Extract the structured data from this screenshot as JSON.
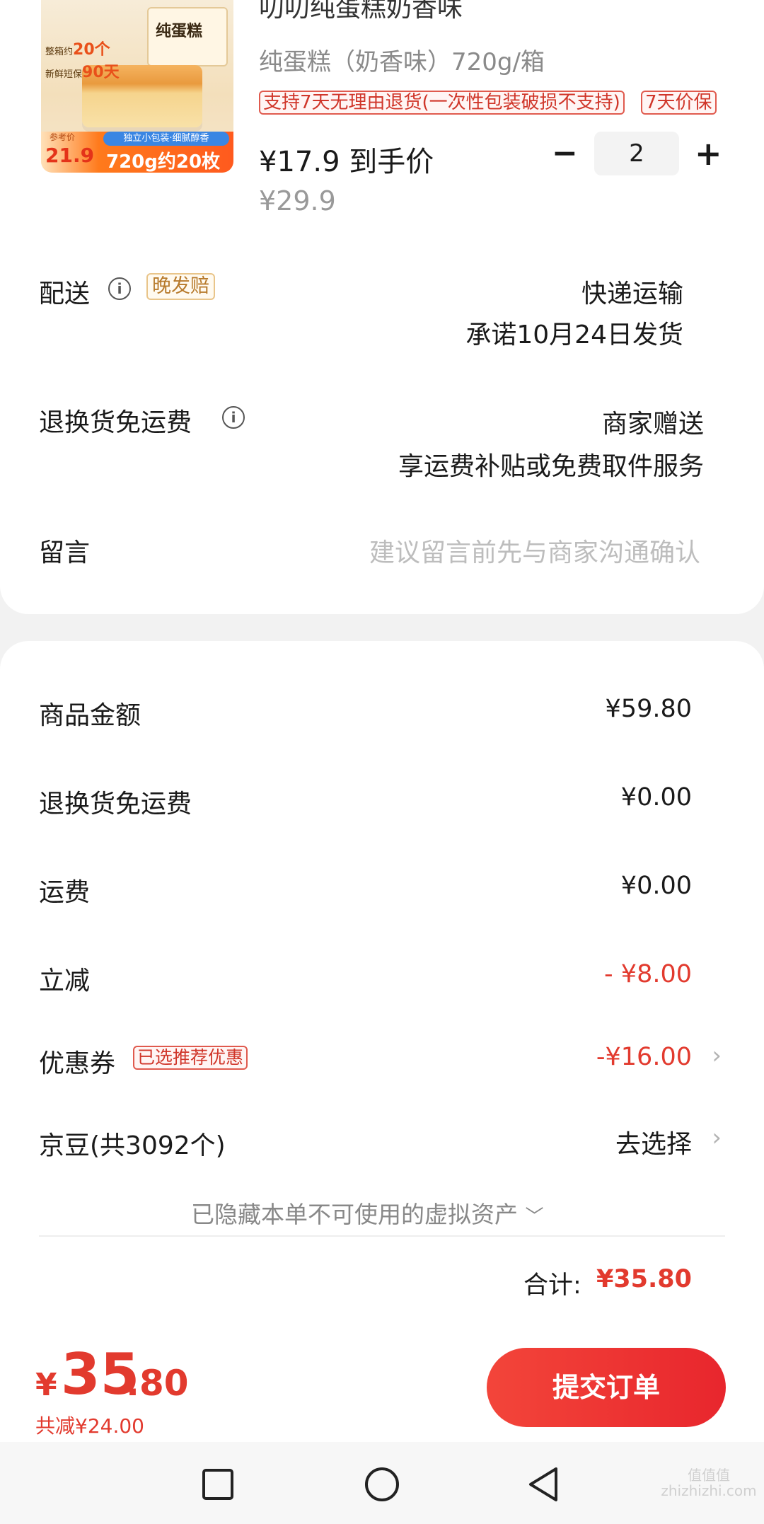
{
  "product": {
    "title_partial": "叨叨纯蛋糕奶香味",
    "spec": "纯蛋糕（奶香味）720g/箱",
    "tag_return": "支持7天无理由退货(一次性包装破损不支持)",
    "tag_price_protect": "7天价保",
    "final_price": "¥17.9 到手价",
    "original_price": "¥29.9",
    "quantity": "2",
    "minus_label": "−",
    "plus_label": "+",
    "image": {
      "box_title": "纯蛋糕",
      "note1_prefix": "整箱约",
      "note1_value": "20个",
      "note2_prefix": "新鲜短保",
      "note2_value": "90天",
      "ref_label": "参考价",
      "ref_price": "21.9",
      "pill": "独立小包装·细腻醇香",
      "spec": "720g约20枚"
    }
  },
  "delivery": {
    "label": "配送",
    "badge": "晚发赔",
    "method": "快递运输",
    "promise": "承诺10月24日发货"
  },
  "return_shipping": {
    "label": "退换货免运费",
    "value1": "商家赠送",
    "value2": "享运费补贴或免费取件服务"
  },
  "message": {
    "label": "留言",
    "placeholder": "建议留言前先与商家沟通确认"
  },
  "summary": {
    "rows": [
      {
        "label": "商品金额",
        "value": "¥59.80"
      },
      {
        "label": "退换货免运费",
        "value": "¥0.00"
      },
      {
        "label": "运费",
        "value": "¥0.00"
      },
      {
        "label": "立减",
        "value": "- ¥8.00"
      }
    ],
    "coupon_label": "优惠券",
    "coupon_badge": "已选推荐优惠",
    "coupon_value": "-¥16.00",
    "jingdou_label": "京豆(共3092个)",
    "jingdou_action": "去选择",
    "hidden_assets": "已隐藏本单不可使用的虚拟资产",
    "total_label": "合计:",
    "total_value": "¥35.80"
  },
  "bottom": {
    "currency": "¥",
    "price_int": "35",
    "price_dec": ".80",
    "saved": "共减¥24.00",
    "submit": "提交订单"
  },
  "watermark": "值值值 zhizhizhi.com",
  "colors": {
    "accent": "#e23a2e",
    "gold": "#b77a2b"
  }
}
